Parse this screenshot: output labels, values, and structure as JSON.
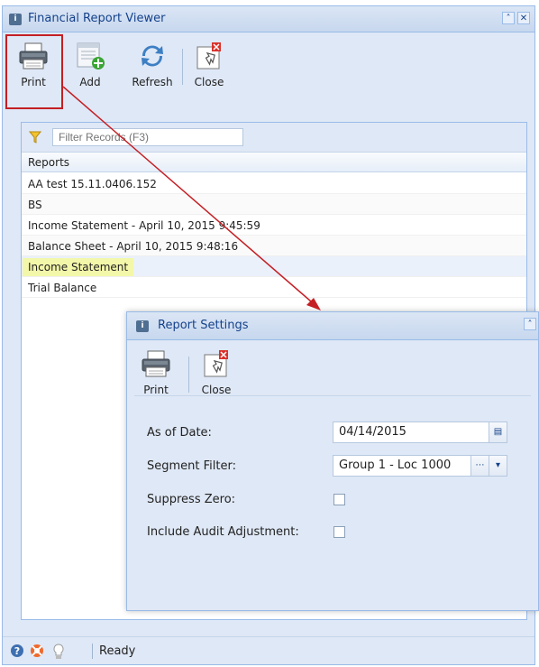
{
  "main_window": {
    "title": "Financial Report Viewer",
    "toolbar": {
      "print_label": "Print",
      "add_label": "Add",
      "refresh_label": "Refresh",
      "close_label": "Close"
    },
    "filter": {
      "placeholder": "Filter Records (F3)"
    },
    "grid": {
      "column_header": "Reports",
      "rows": [
        "AA test 15.11.0406.152",
        "BS",
        "Income Statement - April 10, 2015 9:45:59",
        "Balance Sheet - April 10, 2015 9:48:16",
        "Income Statement",
        "Trial Balance"
      ]
    },
    "status": {
      "text": "Ready"
    }
  },
  "dialog": {
    "title": "Report Settings",
    "toolbar": {
      "print_label": "Print",
      "close_label": "Close"
    },
    "fields": {
      "as_of_date_label": "As of Date:",
      "as_of_date_value": "04/14/2015",
      "segment_filter_label": "Segment Filter:",
      "segment_filter_value": "Group 1 - Loc 1000",
      "suppress_zero_label": "Suppress Zero:",
      "include_audit_label": "Include Audit Adjustment:"
    }
  },
  "colors": {
    "panel_bg": "#dfe8f6",
    "border": "#99bbe8",
    "title_text": "#15428b",
    "highlight_box": "#c41f24",
    "selected_row_highlight": "#f3f7a9",
    "annotation_arrow": "#c41f24"
  },
  "icons": [
    "printer-icon",
    "add-report-icon",
    "refresh-icon",
    "close-window-icon",
    "filter-icon",
    "help-icon",
    "support-icon",
    "lightbulb-icon",
    "collapse-icon",
    "window-close-icon",
    "calendar-icon",
    "ellipsis-icon",
    "chevron-down-icon"
  ]
}
